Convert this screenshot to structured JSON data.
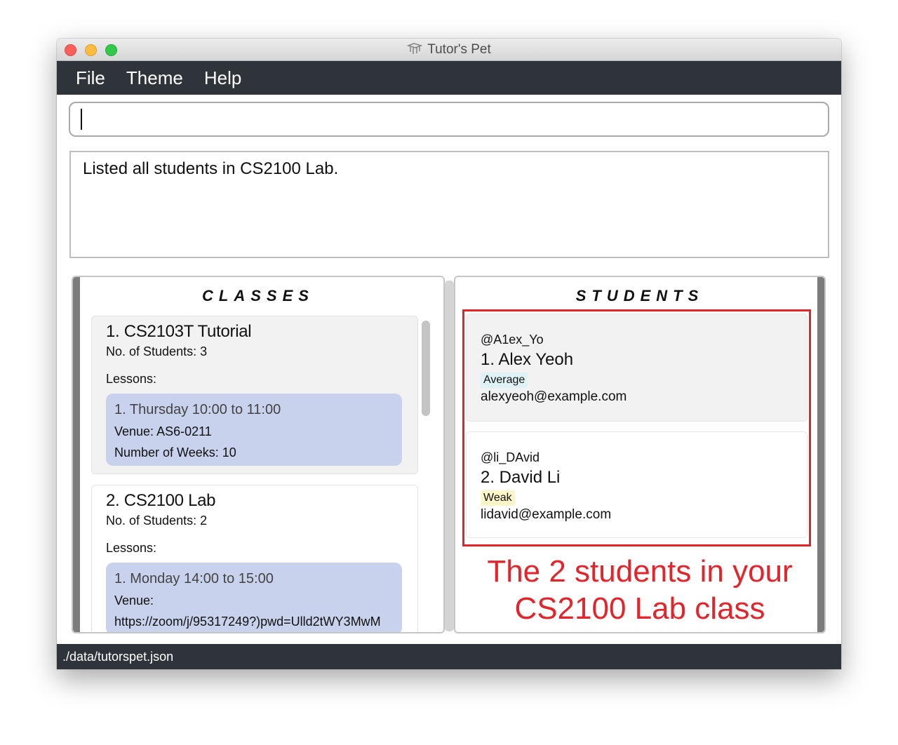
{
  "window": {
    "title": "Tutor's Pet"
  },
  "menu": {
    "file": "File",
    "theme": "Theme",
    "help": "Help"
  },
  "command": {
    "value": ""
  },
  "result": {
    "text": "Listed all students in CS2100 Lab."
  },
  "classes": {
    "title": "CLASSES",
    "items": [
      {
        "name": "1.  CS2103T Tutorial",
        "count": "No. of Students:  3",
        "lessons_label": "Lessons:",
        "lesson": {
          "time": "1. Thursday 10:00 to 11:00",
          "venue": "Venue: AS6-0211",
          "weeks": "Number of Weeks: 10"
        }
      },
      {
        "name": "2.  CS2100 Lab",
        "count": "No. of Students:  2",
        "lessons_label": "Lessons:",
        "lesson": {
          "time": "1. Monday 14:00 to 15:00",
          "venue": "Venue:",
          "venue_url": "https://zoom/j/95317249?)pwd=Ulld2tWY3MwM"
        }
      }
    ]
  },
  "students": {
    "title": "STUDENTS",
    "items": [
      {
        "handle": "@A1ex_Yo",
        "name": "1.  Alex Yeoh",
        "tag": "Average",
        "email": "alexyeoh@example.com"
      },
      {
        "handle": "@li_DAvid",
        "name": "2.  David Li",
        "tag": "Weak",
        "email": "lidavid@example.com"
      }
    ]
  },
  "annotation": {
    "line1": "The 2 students in your",
    "line2": "CS2100 Lab class"
  },
  "status": {
    "path": "./data/tutorspet.json"
  },
  "colors": {
    "accent": "#e3242b",
    "menubar": "#2f343b",
    "lesson": "#c9d2ec"
  }
}
